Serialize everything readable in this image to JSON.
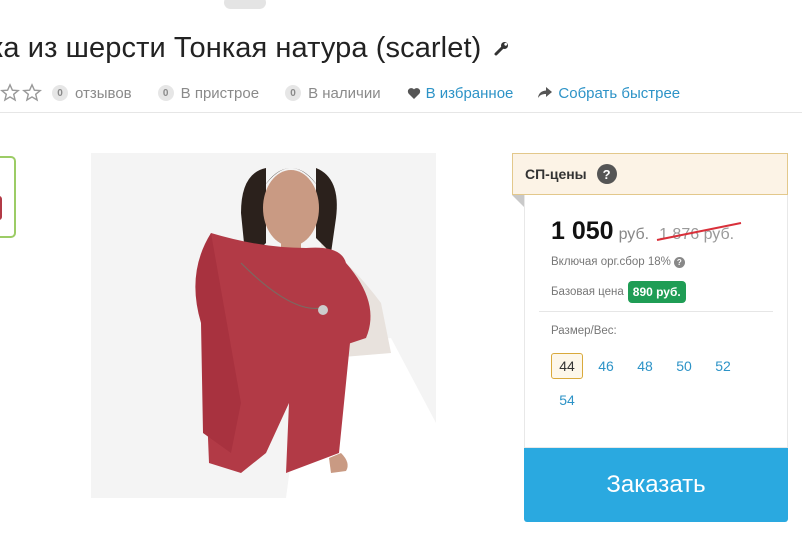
{
  "product": {
    "title": "ка из шерсти Тонкая натура (scarlet)"
  },
  "meta": {
    "rating_stars": 0,
    "reviews": {
      "count": "0",
      "label": "отзывов"
    },
    "pristroy": {
      "count": "0",
      "label": "В пристрое"
    },
    "in_stock": {
      "count": "0",
      "label": "В наличии"
    },
    "favorites_label": "В избранное",
    "collect_faster_label": "Собрать быстрее"
  },
  "pricing": {
    "header_label": "СП-цены",
    "help_icon": "?",
    "price": "1 050",
    "currency": "руб.",
    "old_price": "1 876 руб.",
    "fee_text": "Включая орг.сбор 18%",
    "fee_help_icon": "?",
    "base_label": "Базовая цена",
    "base_price": "890 руб.",
    "size_label": "Размер/Вес:",
    "sizes": [
      "44",
      "46",
      "48",
      "50",
      "52",
      "54"
    ],
    "selected_size": "44",
    "order_label": "Заказать"
  },
  "colors": {
    "accent": "#2aa9e0",
    "link": "#2d93c7",
    "badge_green": "#1f9d55",
    "strike_red": "#d9303a",
    "sweater": "#b23a46"
  }
}
